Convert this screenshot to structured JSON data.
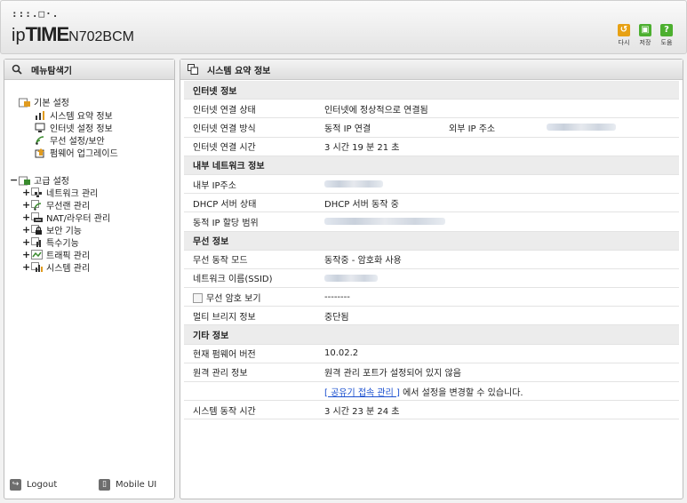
{
  "header": {
    "logo_dots": ":::.□·.",
    "logo_prefix": "ip",
    "logo_mark": "TIME",
    "logo_model": "N702BCM",
    "tools": [
      {
        "label": "다시",
        "icon": "refresh-icon",
        "color": "#e7a114"
      },
      {
        "label": "저장",
        "icon": "save-icon",
        "color": "#4caf2f"
      },
      {
        "label": "도움",
        "icon": "help-icon",
        "color": "#4caf2f"
      }
    ]
  },
  "sidebar": {
    "title": "메뉴탐색기",
    "basic": {
      "label": "기본 설정",
      "items": [
        "시스템 요약 정보",
        "인터넷 설정 정보",
        "무선 설정/보안",
        "펌웨어 업그레이드"
      ]
    },
    "advanced": {
      "toggle": "−",
      "label": "고급 설정",
      "items": [
        "네트워크 관리",
        "무선랜 관리",
        "NAT/라우터 관리",
        "보안 기능",
        "특수기능",
        "트래픽 관리",
        "시스템 관리"
      ],
      "expand_symbol": "+"
    },
    "footer": {
      "logout": "Logout",
      "mobile": "Mobile UI"
    }
  },
  "main": {
    "title": "시스템 요약 정보",
    "rows": [
      {
        "type": "section",
        "label": "인터넷 정보"
      },
      {
        "type": "row",
        "label": "인터넷 연결 상태",
        "value": "인터넷에 정상적으로 연결됨"
      },
      {
        "type": "row",
        "label": "인터넷 연결 방식",
        "value": "동적 IP 연결",
        "extra_label": "외부 IP 주소"
      },
      {
        "type": "row",
        "label": "인터넷 연결 시간",
        "value": "3 시간 19 분 21 초"
      },
      {
        "type": "section",
        "label": "내부 네트워크 정보"
      },
      {
        "type": "row",
        "label": "내부 IP주소",
        "value": ""
      },
      {
        "type": "row",
        "label": "DHCP 서버 상태",
        "value": "DHCP 서버 동작 중"
      },
      {
        "type": "row",
        "label": "동적 IP 할당 범위",
        "value": ""
      },
      {
        "type": "section",
        "label": "무선 정보"
      },
      {
        "type": "row",
        "label": "무선 동작 모드",
        "value": "동작중 - 암호화 사용"
      },
      {
        "type": "row",
        "label": "네트워크 이름(SSID)",
        "value": ""
      },
      {
        "type": "row",
        "label": "무선 암호 보기",
        "value": "--------"
      },
      {
        "type": "row",
        "label": "멀티 브리지 정보",
        "value": "중단됨"
      },
      {
        "type": "section",
        "label": "기타 정보"
      },
      {
        "type": "row",
        "label": "현재 펌웨어 버전",
        "value": "10.02.2"
      },
      {
        "type": "row",
        "label": "원격 관리 정보",
        "value": "원격 관리 포트가 설정되어 있지 않음"
      },
      {
        "type": "row",
        "label": "",
        "value": ""
      },
      {
        "type": "row",
        "label": "시스템 동작 시간",
        "value": "3 시간 23 분 24 초"
      }
    ],
    "remote_link": "[ 공유기 접속 관리 ]",
    "remote_suffix": " 에서 설정을 변경할 수 있습니다."
  }
}
